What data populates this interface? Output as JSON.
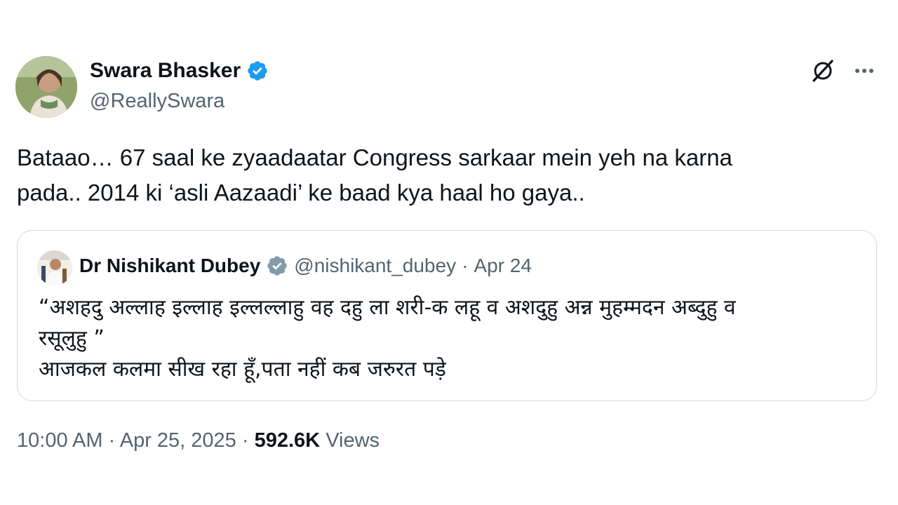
{
  "author": {
    "name": "Swara Bhasker",
    "handle": "@ReallySwara"
  },
  "icons": {
    "verified": "verified-badge-icon",
    "grok": "grok-icon",
    "more": "more-options-icon"
  },
  "colors": {
    "verified": "#1d9bf0",
    "quote_verified": "#829aab",
    "secondary_text": "#536471",
    "primary_text": "#0f1419",
    "border": "#cfd9de"
  },
  "tweet": {
    "text_line1": "Bataao… 67 saal ke zyaadaatar Congress sarkaar mein yeh na karna",
    "text_line2": "pada.. 2014 ki ‘asli Aazaadi’ ke baad kya haal ho gaya.."
  },
  "quote": {
    "name": "Dr Nishikant Dubey",
    "handle": "@nishikant_dubey",
    "separator": "·",
    "date": "Apr 24",
    "line1": "“अशहदु अल्लाह इल्लाह इल्लल्लाहु वह दहु ला शरी-क लहू व अशदुहु अन्न मुहम्मदन अब्दुहु व",
    "line2": "रसूलुहु ”",
    "line3": "आजकल कलमा सीख रहा हूँ,पता नहीं कब जरुरत पड़े"
  },
  "meta": {
    "time": "10:00 AM",
    "separator": "·",
    "date": "Apr 25, 2025",
    "views_count": "592.6K",
    "views_label": "Views"
  }
}
